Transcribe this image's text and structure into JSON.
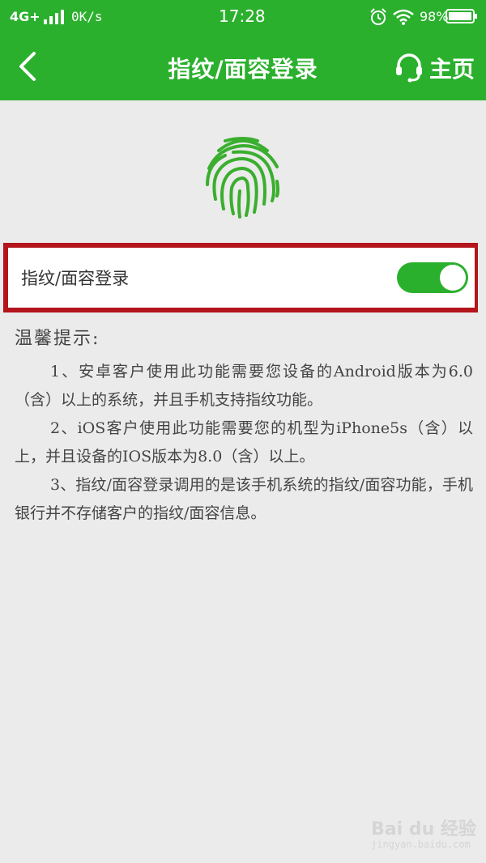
{
  "status_bar": {
    "network": "4G+",
    "speed": "0K/s",
    "time": "17:28",
    "battery_percent": "98%"
  },
  "header": {
    "title": "指纹/面容登录",
    "home_label": "主页",
    "icons": [
      "back-arrow-icon",
      "headset-icon"
    ]
  },
  "setting": {
    "label": "指纹/面容登录",
    "enabled": true
  },
  "tips": {
    "title": "温馨提示:",
    "items": [
      "1、安卓客户使用此功能需要您设备的Android版本为6.0（含）以上的系统，并且手机支持指纹功能。",
      "2、iOS客户使用此功能需要您的机型为iPhone5s（含）以上，并且设备的IOS版本为8.0（含）以上。",
      "3、指纹/面容登录调用的是该手机系统的指纹/面容功能，手机银行并不存储客户的指纹/面容信息。"
    ]
  },
  "watermark": {
    "logo": "Bai du 经验",
    "url": "jingyan.baidu.com"
  },
  "colors": {
    "primary_green": "#2bb02e",
    "highlight_red": "#b4141c",
    "background": "#ebebeb"
  }
}
